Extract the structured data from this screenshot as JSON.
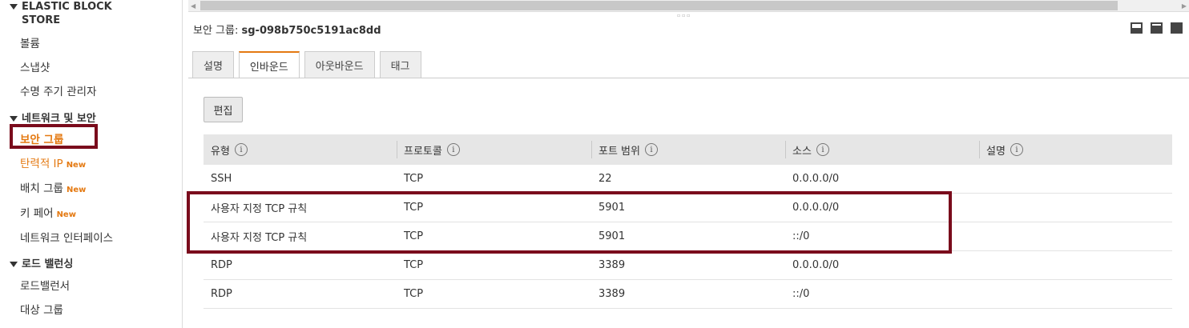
{
  "sidebar": {
    "ebs_header": "ELASTIC BLOCK STORE",
    "ebs_items": [
      "볼륨",
      "스냅샷",
      "수명 주기 관리자"
    ],
    "network_header": "네트워크 및 보안",
    "network_items": [
      {
        "label": "보안 그룹",
        "badge": ""
      },
      {
        "label": "탄력적 IP",
        "badge": "New"
      },
      {
        "label": "배치 그룹",
        "badge": "New"
      },
      {
        "label": "키 페어",
        "badge": "New"
      },
      {
        "label": "네트워크 인터페이스",
        "badge": ""
      }
    ],
    "lb_header": "로드 밸런싱",
    "lb_items": [
      "로드밸런서",
      "대상 그룹"
    ]
  },
  "detail": {
    "title_prefix": "보안 그룹: ",
    "group_id": "sg-098b750c5191ac8dd"
  },
  "tabs": [
    "설명",
    "인바운드",
    "아웃바운드",
    "태그"
  ],
  "active_tab": "인바운드",
  "edit_label": "편집",
  "table": {
    "headers": [
      "유형",
      "프로토콜",
      "포트 범위",
      "소스",
      "설명"
    ],
    "info_glyph": "i",
    "rows": [
      [
        "SSH",
        "TCP",
        "22",
        "0.0.0.0/0",
        ""
      ],
      [
        "사용자 지정 TCP 규칙",
        "TCP",
        "5901",
        "0.0.0.0/0",
        ""
      ],
      [
        "사용자 지정 TCP 규칙",
        "TCP",
        "5901",
        "::/0",
        ""
      ],
      [
        "RDP",
        "TCP",
        "3389",
        "0.0.0.0/0",
        ""
      ],
      [
        "RDP",
        "TCP",
        "3389",
        "::/0",
        ""
      ]
    ]
  },
  "colors": {
    "accent": "#e47911",
    "highlight": "#7a0b1c"
  }
}
